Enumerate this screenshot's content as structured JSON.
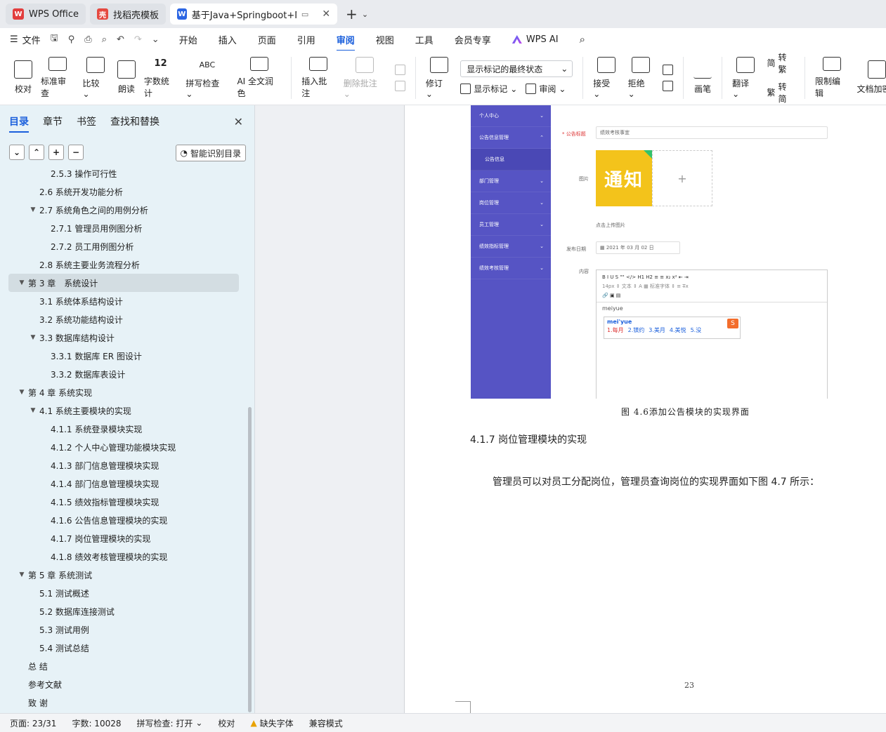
{
  "tabs": [
    {
      "label": "WPS Office",
      "logo": "W",
      "color": "#e23d3d"
    },
    {
      "label": "找稻壳模板",
      "logo": "壳",
      "color": "#e5483f"
    },
    {
      "label": "基于Java+Springboot+MyS",
      "logo": "W",
      "color": "#2b65e3"
    }
  ],
  "menu": {
    "file_label": "文件",
    "items": [
      "开始",
      "插入",
      "页面",
      "引用",
      "审阅",
      "视图",
      "工具",
      "会员专享"
    ],
    "active": "审阅",
    "ai_label": "WPS AI"
  },
  "ribbon": {
    "proofread": "校对",
    "standard_review": "标准审查",
    "compare": "比较",
    "read_aloud": "朗读",
    "word_count": "字数统计",
    "spell_check": "拼写检查",
    "ai_polish": "AI 全文润色",
    "insert_comment": "插入批注",
    "delete_comment": "删除批注",
    "track_changes": "修订",
    "markup_select": "显示标记的最终状态",
    "show_markup": "显示标记",
    "review_pane": "审阅",
    "accept": "接受",
    "reject": "拒绝",
    "pen": "画笔",
    "translate": "翻译",
    "to_traditional": "转繁",
    "to_simplified": "转简",
    "restrict_edit": "限制编辑",
    "doc_encrypt": "文档加密"
  },
  "nav": {
    "tabs": [
      "目录",
      "章节",
      "书签",
      "查找和替换"
    ],
    "smart_toc": "智能识别目录",
    "toc": [
      {
        "label": "2.5.3 操作可行性",
        "level": 3,
        "arrow": ""
      },
      {
        "label": "2.6 系统开发功能分析",
        "level": 2,
        "arrow": ""
      },
      {
        "label": "2.7 系统角色之间的用例分析",
        "level": 2,
        "arrow": "▼"
      },
      {
        "label": "2.7.1 管理员用例图分析",
        "level": 3,
        "arrow": ""
      },
      {
        "label": "2.7.2 员工用例图分析",
        "level": 3,
        "arrow": ""
      },
      {
        "label": "2.8 系统主要业务流程分析",
        "level": 2,
        "arrow": ""
      },
      {
        "label": "第 3 章　系统设计",
        "level": 1,
        "arrow": "▼",
        "selected": true
      },
      {
        "label": "3.1 系统体系结构设计",
        "level": 2,
        "arrow": ""
      },
      {
        "label": "3.2 系统功能结构设计",
        "level": 2,
        "arrow": ""
      },
      {
        "label": "3.3 数据库结构设计",
        "level": 2,
        "arrow": "▼"
      },
      {
        "label": "3.3.1 数据库 ER 图设计",
        "level": 3,
        "arrow": ""
      },
      {
        "label": "3.3.2 数据库表设计",
        "level": 3,
        "arrow": ""
      },
      {
        "label": "第 4 章  系统实现",
        "level": 1,
        "arrow": "▼"
      },
      {
        "label": "4.1 系统主要模块的实现",
        "level": 2,
        "arrow": "▼"
      },
      {
        "label": "4.1.1 系统登录模块实现",
        "level": 3,
        "arrow": ""
      },
      {
        "label": "4.1.2 个人中心管理功能模块实现",
        "level": 3,
        "arrow": ""
      },
      {
        "label": "4.1.3 部门信息管理模块实现",
        "level": 3,
        "arrow": ""
      },
      {
        "label": "4.1.4 部门信息管理模块实现",
        "level": 3,
        "arrow": ""
      },
      {
        "label": "4.1.5 绩效指标管理模块实现",
        "level": 3,
        "arrow": ""
      },
      {
        "label": "4.1.6 公告信息管理模块的实现",
        "level": 3,
        "arrow": ""
      },
      {
        "label": "4.1.7 岗位管理模块的实现",
        "level": 3,
        "arrow": ""
      },
      {
        "label": "4.1.8 绩效考核管理模块的实现",
        "level": 3,
        "arrow": ""
      },
      {
        "label": "第 5 章  系统测试",
        "level": 1,
        "arrow": "▼"
      },
      {
        "label": "5.1 测试概述",
        "level": 2,
        "arrow": ""
      },
      {
        "label": "5.2 数据库连接测试",
        "level": 2,
        "arrow": ""
      },
      {
        "label": "5.3 测试用例",
        "level": 2,
        "arrow": ""
      },
      {
        "label": "5.4 测试总结",
        "level": 2,
        "arrow": ""
      },
      {
        "label": "总  结",
        "level": 1,
        "arrow": ""
      },
      {
        "label": "参考文献",
        "level": 1,
        "arrow": ""
      },
      {
        "label": "致  谢",
        "level": 1,
        "arrow": ""
      }
    ]
  },
  "doc": {
    "embedded": {
      "menu": [
        "个人中心",
        "公告信息管理",
        "公告信息",
        "部门管理",
        "岗位管理",
        "员工管理",
        "绩效指标管理",
        "绩效考核管理"
      ],
      "title_label": "* 公告标题",
      "title_value": "绩效考核事宜",
      "image_label": "图片",
      "notice_text": "通知",
      "upload_hint": "点击上传图片",
      "date_label": "发布日期",
      "date_value": "2021 年 03 月 02 日",
      "content_label": "内容",
      "editor_row1": "B  I  U  S    \"\"  </>    H1  H2    ≡  ≡    x₂  x²    ⇤  ⇥",
      "editor_row2": "14px  ⇕    文本  ⇕    A  ▦    标准字体  ⇕    ≡    T̶x",
      "editor_row3": "🔗  ▣  ▤",
      "typed": "meiyue",
      "ime_pinyin": "mei'yue",
      "ime_candidates": [
        "1.每月",
        "2.镁约",
        "3.美月",
        "4.美悦",
        "5.没"
      ]
    },
    "caption": "图 4.6添加公告模块的实现界面",
    "heading": "4.1.7 岗位管理模块的实现",
    "paragraph": "管理员可以对员工分配岗位，管理员查询岗位的实现界面如下图 4.7 所示：",
    "page_number": "23"
  },
  "status": {
    "page": "页面: 23/31",
    "words": "字数: 10028",
    "spell": "拼写检查: 打开",
    "proof": "校对",
    "missing_font": "缺失字体",
    "compat": "兼容模式"
  }
}
